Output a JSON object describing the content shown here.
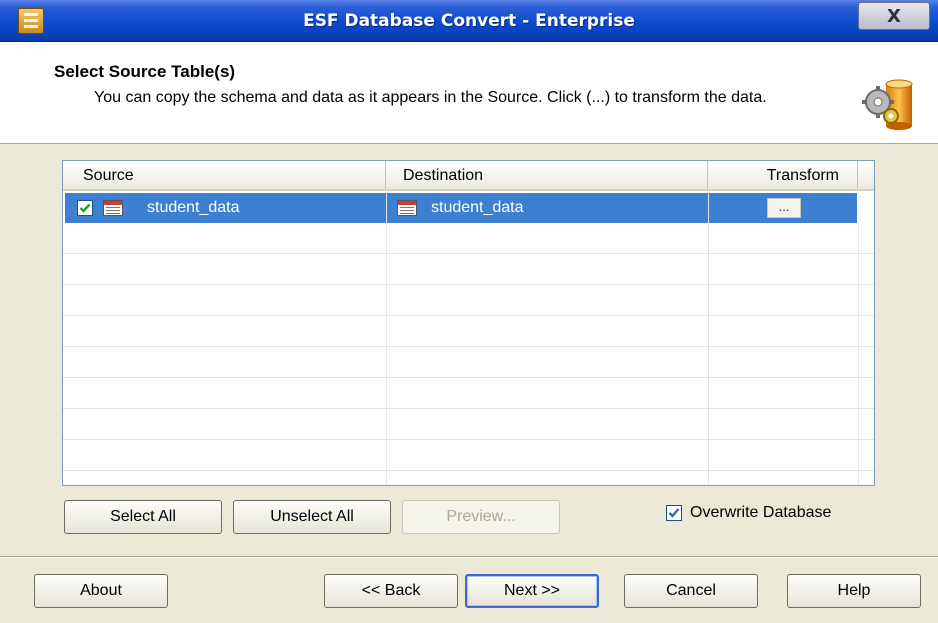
{
  "window": {
    "title": "ESF Database Convert - Enterprise",
    "close_label": "X"
  },
  "header": {
    "title": "Select Source Table(s)",
    "description": "You can copy the schema and data as it appears in the Source. Click (...) to transform the data."
  },
  "table": {
    "columns": [
      "Source",
      "Destination",
      "Transform"
    ],
    "rows": [
      {
        "checked": true,
        "source": "student_data",
        "destination": "student_data",
        "transform": "..."
      }
    ]
  },
  "actions": {
    "select_all": "Select All",
    "unselect_all": "Unselect All",
    "preview": "Preview...",
    "overwrite_label": "Overwrite Database",
    "overwrite_checked": true
  },
  "footer": {
    "about": "About",
    "back": "<< Back",
    "next": "Next >>",
    "cancel": "Cancel",
    "help": "Help"
  },
  "colors": {
    "selection": "#3d7fd1",
    "titlebar": "#0d4bd0",
    "dialog_bg": "#ece9d8"
  }
}
